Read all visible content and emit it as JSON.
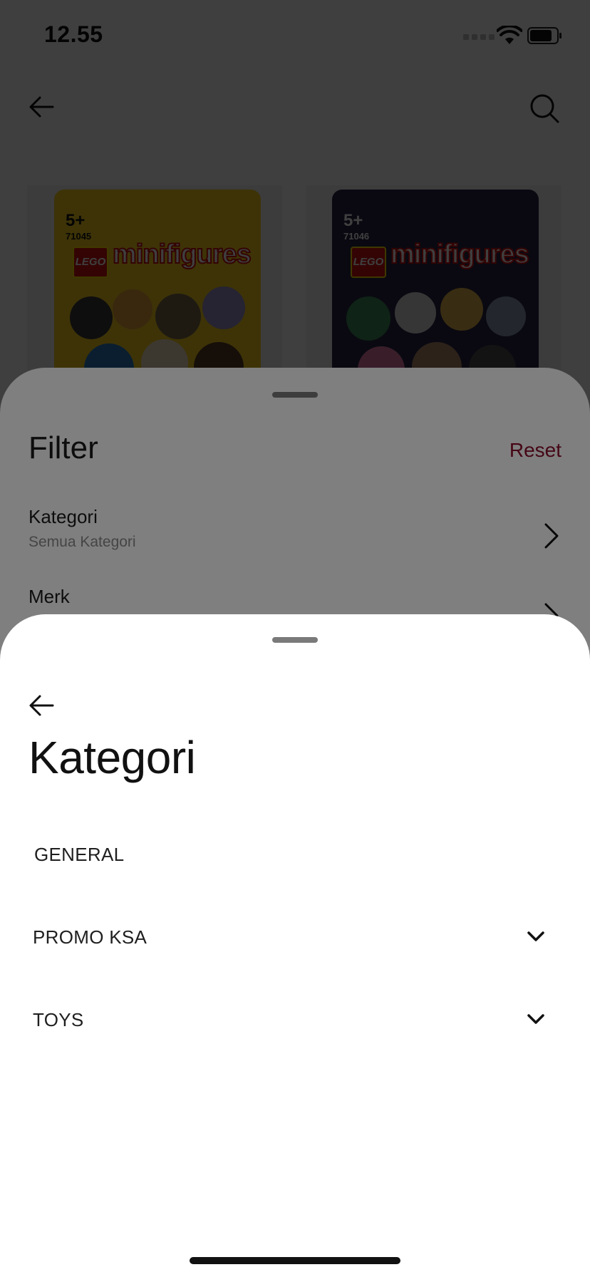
{
  "status_bar": {
    "time": "12.55",
    "icons": [
      "signal-icon",
      "wifi-icon",
      "battery-icon"
    ]
  },
  "nav_bar": {
    "icons": [
      "back-arrow-icon",
      "search-icon"
    ]
  },
  "products": [
    {
      "box_age": "5+",
      "box_code": "71045",
      "box_logo": "LEGO",
      "box_brand": "minifigures"
    },
    {
      "box_age": "5+",
      "box_code": "71046",
      "box_logo": "LEGO",
      "box_brand": "minifigures"
    }
  ],
  "filter_sheet": {
    "title": "Filter",
    "reset_label": "Reset",
    "rows": [
      {
        "label": "Kategori",
        "value": "Semua Kategori"
      },
      {
        "label": "Merk",
        "value": ""
      }
    ]
  },
  "category_sheet": {
    "title": "Kategori",
    "items": [
      {
        "label": "GENERAL",
        "expandable": false
      },
      {
        "label": "PROMO KSA",
        "expandable": true
      },
      {
        "label": "TOYS",
        "expandable": true
      }
    ]
  },
  "colors": {
    "accent": "#8b0e2c",
    "overlay": "rgba(0,0,0,0.5)",
    "text_primary": "#111111",
    "text_secondary": "#8a8a8a"
  }
}
